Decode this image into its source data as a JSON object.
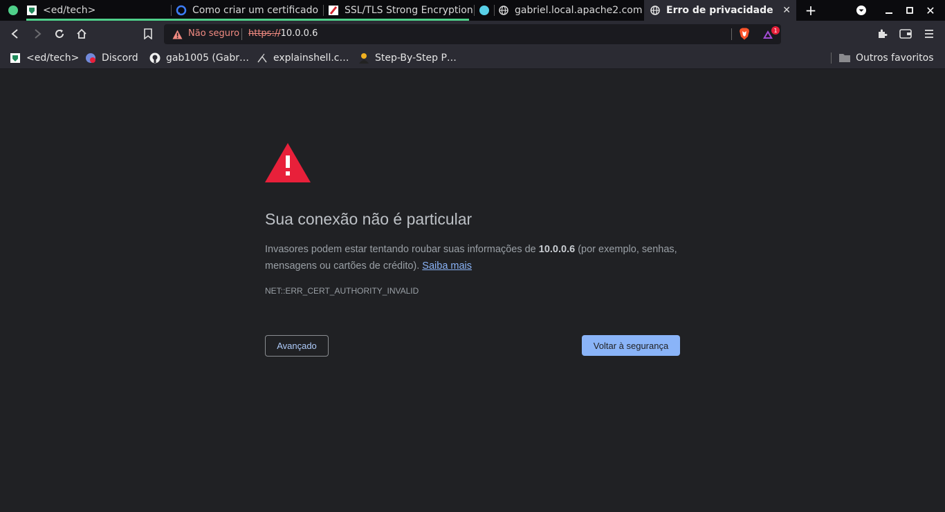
{
  "tabs": [
    {
      "title": "<ed/tech>",
      "icon": "edtech-shield-icon"
    },
    {
      "title": "Como criar um certificado",
      "icon": "digitalocean-icon"
    },
    {
      "title": "SSL/TLS Strong Encryption",
      "icon": "apache-feather-icon"
    },
    {
      "title": "",
      "icon": "circle-icon"
    },
    {
      "title": "gabriel.local.apache2.com",
      "icon": "globe-icon"
    },
    {
      "title": "Erro de privacidade",
      "icon": "globe-icon",
      "active": true
    }
  ],
  "address_bar": {
    "security_label": "Não seguro",
    "url_scheme": "https://",
    "url_host": "10.0.0.6"
  },
  "rewards_badge": "1",
  "bookmarks": [
    {
      "label": "<ed/tech>",
      "icon": "edtech-shield-icon"
    },
    {
      "label": "Discord",
      "icon": "discord-icon"
    },
    {
      "label": "gab1005 (Gabr…",
      "icon": "github-icon"
    },
    {
      "label": "explainshell.c…",
      "icon": "explainshell-icon"
    },
    {
      "label": "Step-By-Step P…",
      "icon": "avatar-icon"
    }
  ],
  "other_bookmarks": "Outros favoritos",
  "error_page": {
    "heading": "Sua conexão não é particular",
    "desc_before": "Invasores podem estar tentando roubar suas informações de ",
    "desc_host": "10.0.0.6",
    "desc_after": " (por exemplo, senhas, mensagens ou cartões de crédito). ",
    "learn_more": "Saiba mais",
    "error_code": "NET::ERR_CERT_AUTHORITY_INVALID",
    "advanced_button": "Avançado",
    "back_button": "Voltar à segurança"
  },
  "colors": {
    "warning_red": "#e8203a",
    "link_blue": "#8ab4f8",
    "page_bg": "#202124"
  }
}
